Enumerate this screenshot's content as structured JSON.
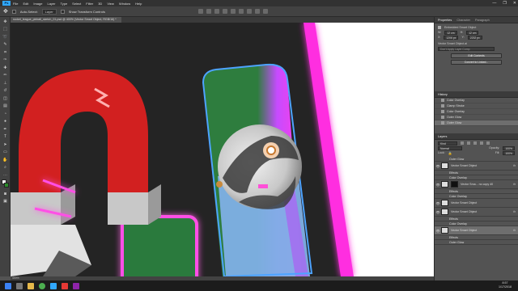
{
  "app": {
    "logo": "Ps"
  },
  "menu": [
    "File",
    "Edit",
    "Image",
    "Layer",
    "Type",
    "Select",
    "Filter",
    "3D",
    "View",
    "Window",
    "Help"
  ],
  "window_controls": [
    "—",
    "❐",
    "✕"
  ],
  "options_bar": {
    "auto_select_label": "Auto-Select:",
    "auto_select_value": "Layer",
    "show_transform_label": "Show Transform Controls"
  },
  "document_tab": {
    "title": "rocket_league_pinball_sketch_01.psd @ 400% (Vector Smart Object, RGB/16) *"
  },
  "status_bar": {
    "zoom": "400%"
  },
  "properties": {
    "tabs": [
      "Properties",
      "Character",
      "Paragraph"
    ],
    "type_label": "Embedded Smart Object",
    "w_label": "W:",
    "w_value": "12 cm",
    "h_label": "H:",
    "h_value": "12 cm",
    "x_label": "X:",
    "x_value": "1206 px",
    "y_label": "Y:",
    "y_value": "2232 px",
    "vector_label": "Vector Smart Object.ai",
    "layer_comp_placeholder": "Don't Apply Layer Comp",
    "edit_contents_label": "Edit Contents",
    "convert_label": "Convert to Linked..."
  },
  "history": {
    "title": "History",
    "items": [
      "Color Overlay",
      "Clamp Stroke",
      "Color Overlay",
      "Outer Glow",
      "Outer Glow"
    ],
    "selected_index": 4
  },
  "layers": {
    "title": "Layers",
    "kind_label": "Kind",
    "blend_mode": "Normal",
    "opacity_label": "Opacity:",
    "opacity_value": "100%",
    "lock_label": "Lock:",
    "fill_label": "Fill:",
    "fill_value": "100%",
    "rows": [
      {
        "name": "Outer Glow",
        "type": "effect"
      },
      {
        "name": "Vector Smart Object",
        "type": "layer",
        "thumb": "light"
      },
      {
        "name": "Effects",
        "type": "effect"
      },
      {
        "name": "Color Overlay",
        "type": "effect"
      },
      {
        "name": "Vector Sma... no copy 40",
        "type": "layer",
        "thumb": "dark"
      },
      {
        "name": "Effects",
        "type": "effect"
      },
      {
        "name": "Color Overlay",
        "type": "effect"
      },
      {
        "name": "Vector Smart Object",
        "type": "layer",
        "thumb": "light"
      },
      {
        "name": "Vector Smart Object",
        "type": "layer",
        "thumb": "light"
      },
      {
        "name": "Effects",
        "type": "effect"
      },
      {
        "name": "Color Overlay",
        "type": "effect"
      },
      {
        "name": "Vector Smart Object",
        "type": "layer",
        "thumb": "light",
        "selected": true
      },
      {
        "name": "Effects",
        "type": "effect"
      },
      {
        "name": "Outer Glow",
        "type": "effect"
      }
    ],
    "fx_label": "fx"
  },
  "taskbar": {
    "time": "8:57",
    "date": "1/17/2018"
  },
  "colors": {
    "accent": "#31a8ff",
    "canvas_bg": "#242424",
    "neon_pink": "#ff2fe0",
    "magnet_red": "#d22020",
    "ramp_green": "#2e7d3e",
    "ramp_blue": "#7fb0e6",
    "selection_blue": "#4da3ff"
  }
}
